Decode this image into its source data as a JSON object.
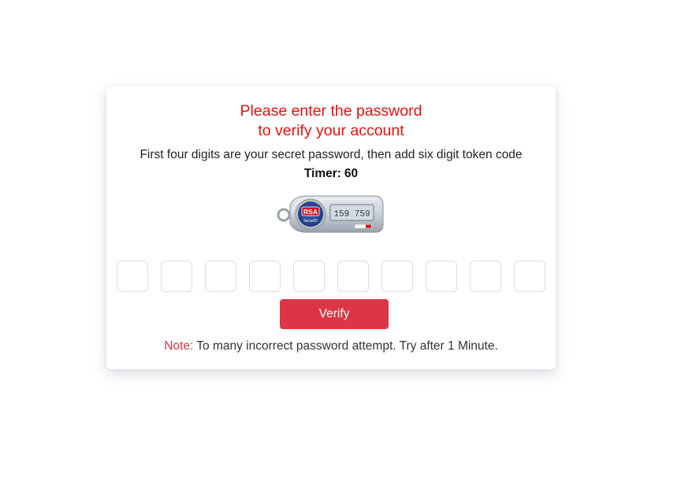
{
  "card": {
    "heading_line1": "Please enter the password",
    "heading_line2": "to verify your account",
    "instruction": "First four digits are your secret password, then add six digit token code",
    "timer_label": "Timer:",
    "timer_value": "60",
    "token_device": {
      "brand": "RSA",
      "sub_brand": "SecurID",
      "display_code": "159 759"
    },
    "digit_inputs": [
      "",
      "",
      "",
      "",
      "",
      "",
      "",
      "",
      "",
      ""
    ],
    "verify_label": "Verify",
    "note_label": "Note:",
    "note_text": "To many incorrect password attempt. Try after 1 Minute."
  },
  "colors": {
    "heading": "#f20d0d",
    "button": "#dc3545",
    "note_label": "#dc3545"
  }
}
